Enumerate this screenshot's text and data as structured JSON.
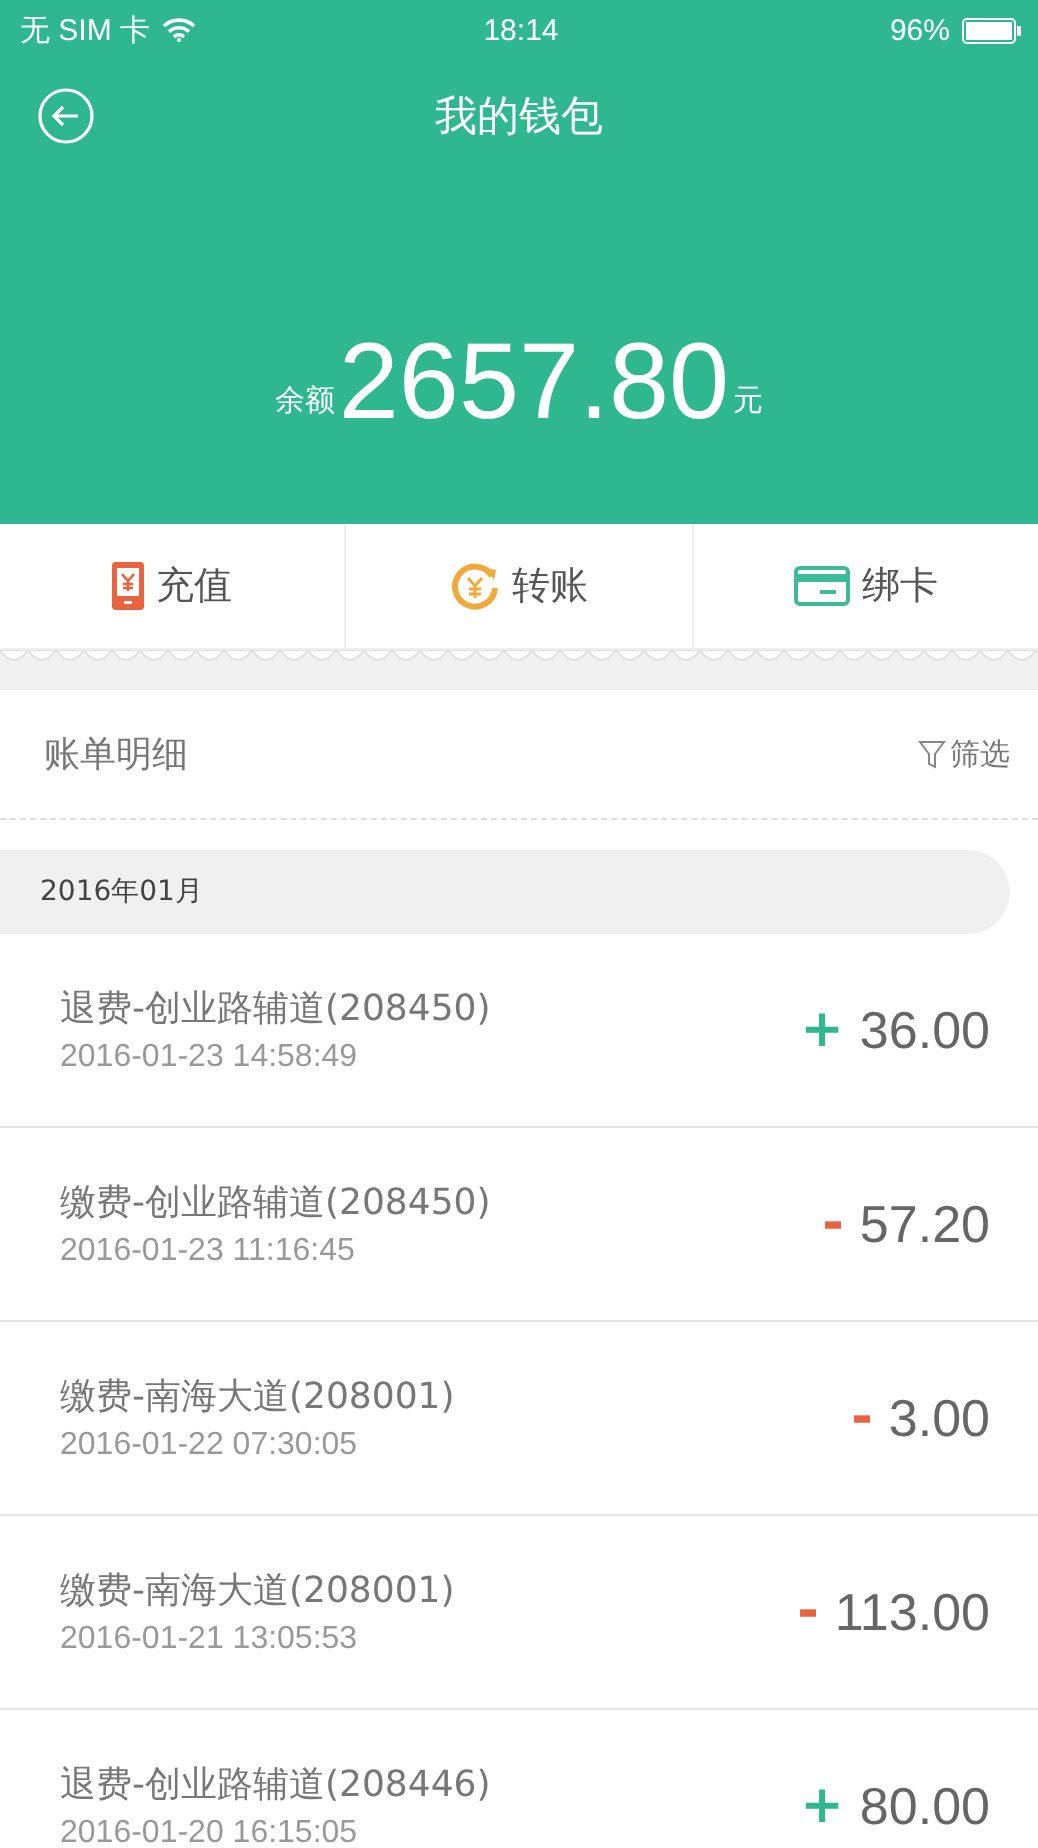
{
  "status_bar": {
    "carrier": "无 SIM 卡",
    "time": "18:14",
    "battery": "96%"
  },
  "header": {
    "title": "我的钱包",
    "balance_prefix": "余额",
    "balance": "2657.80",
    "balance_unit": "元"
  },
  "actions": [
    {
      "kind": "recharge",
      "label": "充值"
    },
    {
      "kind": "transfer",
      "label": "转账"
    },
    {
      "kind": "card",
      "label": "绑卡"
    }
  ],
  "bills": {
    "title": "账单明细",
    "filter": "筛选",
    "month": "2016年01月",
    "rows": [
      {
        "kind": "income",
        "title": "退费-创业路辅道(208450)",
        "time": "2016-01-23 14:58:49",
        "sign": "+",
        "amount": "36.00"
      },
      {
        "kind": "expense",
        "title": "缴费-创业路辅道(208450)",
        "time": "2016-01-23 11:16:45",
        "sign": "-",
        "amount": "57.20"
      },
      {
        "kind": "expense",
        "title": "缴费-南海大道(208001)",
        "time": "2016-01-22 07:30:05",
        "sign": "-",
        "amount": "3.00"
      },
      {
        "kind": "expense",
        "title": "缴费-南海大道(208001)",
        "time": "2016-01-21 13:05:53",
        "sign": "-",
        "amount": "113.00"
      },
      {
        "kind": "income",
        "title": "退费-创业路辅道(208446)",
        "time": "2016-01-20 16:15:05",
        "sign": "+",
        "amount": "80.00"
      }
    ]
  }
}
